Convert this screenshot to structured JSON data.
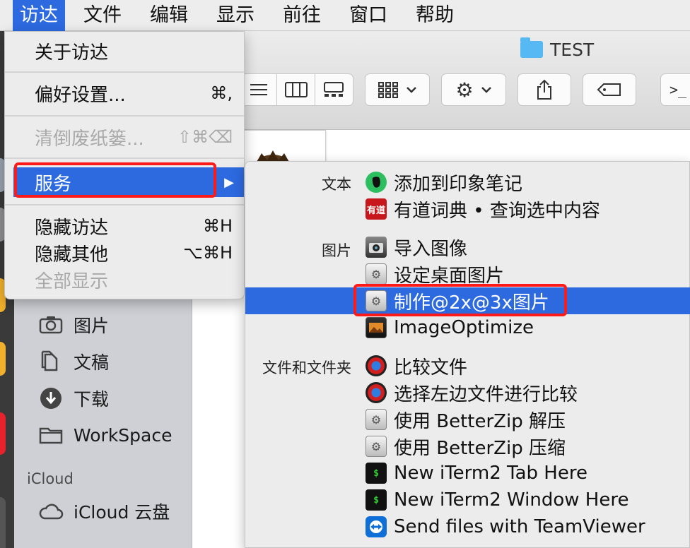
{
  "menubar": {
    "items": [
      "访达",
      "文件",
      "编辑",
      "显示",
      "前往",
      "窗口",
      "帮助"
    ],
    "active_index": 0
  },
  "window": {
    "title": "TEST"
  },
  "finder_menu": {
    "about": "关于访达",
    "prefs": {
      "label": "偏好设置...",
      "shortcut": "⌘,"
    },
    "empty_trash": {
      "label": "清倒废纸篓...",
      "shortcut": "⇧⌘⌫"
    },
    "services": {
      "label": "服务",
      "arrow": "▶"
    },
    "hide": {
      "label": "隐藏访达",
      "shortcut": "⌘H"
    },
    "hide_others": {
      "label": "隐藏其他",
      "shortcut": "⌥⌘H"
    },
    "show_all": "全部显示"
  },
  "services": {
    "categories": {
      "text": "文本",
      "images": "图片",
      "files": "文件和文件夹"
    },
    "items": [
      {
        "label": "添加到印象笔记",
        "icon": "evernote-icon"
      },
      {
        "label": "有道词典 • 查询选中内容",
        "icon": "youdao-icon",
        "icon_text": "有道"
      },
      {
        "label": "导入图像",
        "icon": "image-capture-icon"
      },
      {
        "label": "设定桌面图片",
        "icon": "workflow-icon"
      },
      {
        "label": "制作@2x@3x图片",
        "icon": "workflow-icon"
      },
      {
        "label": "ImageOptimize",
        "icon": "imageoptim-icon"
      },
      {
        "label": "比较文件",
        "icon": "compare-icon"
      },
      {
        "label": "选择左边文件进行比较",
        "icon": "compare-icon"
      },
      {
        "label": "使用 BetterZip 解压",
        "icon": "workflow-icon"
      },
      {
        "label": "使用 BetterZip 压缩",
        "icon": "workflow-icon"
      },
      {
        "label": "New iTerm2 Tab Here",
        "icon": "terminal-icon",
        "icon_text": "$"
      },
      {
        "label": "New iTerm2 Window Here",
        "icon": "terminal-icon",
        "icon_text": "$"
      },
      {
        "label": "Send files with TeamViewer",
        "icon": "teamviewer-icon"
      }
    ],
    "highlighted_index": 4
  },
  "sidebar": {
    "items": [
      {
        "label": "图片",
        "icon": "camera-icon"
      },
      {
        "label": "文稿",
        "icon": "document-icon"
      },
      {
        "label": "下载",
        "icon": "download-icon"
      },
      {
        "label": "WorkSpace",
        "icon": "folder-icon"
      }
    ],
    "icloud_section": "iCloud",
    "icloud_drive": {
      "label": "iCloud 云盘",
      "icon": "cloud-icon"
    }
  },
  "colors": {
    "highlight": "#2d6ae0",
    "annotation": "#ff1a1a"
  }
}
